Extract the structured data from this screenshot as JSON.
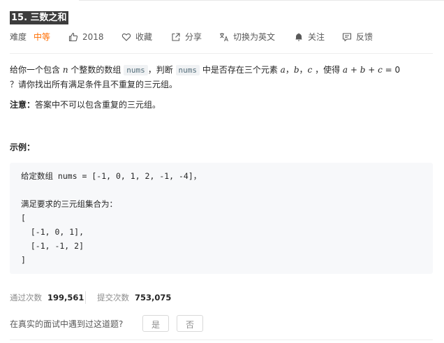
{
  "problem": {
    "title": "15. 三数之和",
    "difficulty_label": "难度",
    "difficulty_value": "中等",
    "likes": "2018",
    "favorite_label": "收藏",
    "share_label": "分享",
    "translate_label": "切换为英文",
    "follow_label": "关注",
    "feedback_label": "反馈"
  },
  "description": {
    "p1_a": "给你一个包含 ",
    "p1_n": "n",
    "p1_b": " 个整数的数组 ",
    "p1_code1": "nums",
    "p1_c": "，判断 ",
    "p1_code2": "nums",
    "p1_d": " 中是否存在三个元素 ",
    "p1_a_var": "a",
    "p1_sep1": "，",
    "p1_b_var": "b",
    "p1_sep2": "，",
    "p1_c_var": "c",
    "p1_e": " ，使得 ",
    "p1_eq": "a + b + c",
    "p1_f": " = 0",
    "p1_line2": "？请你找出所有满足条件且不重复的三元组。",
    "note_label": "注意：",
    "note_text": "答案中不可以包含重复的三元组。"
  },
  "example": {
    "label": "示例：",
    "code": "给定数组 nums = [-1, 0, 1, 2, -1, -4]，\n\n满足要求的三元组集合为：\n[\n  [-1, 0, 1],\n  [-1, -1, 2]\n]"
  },
  "stats": {
    "accepted_label": "通过次数",
    "accepted_value": "199,561",
    "submitted_label": "提交次数",
    "submitted_value": "753,075"
  },
  "interview": {
    "question": "在真实的面试中遇到过这道题?",
    "yes_label": "是",
    "no_label": "否"
  },
  "colors": {
    "difficulty_medium": "#ff6d00",
    "title_bg": "#3c3c3c"
  },
  "icons": {
    "likes": "thumbs-up-icon",
    "favorite": "heart-icon",
    "share": "share-icon",
    "translate": "translate-icon",
    "follow": "bell-icon",
    "feedback": "feedback-icon"
  }
}
